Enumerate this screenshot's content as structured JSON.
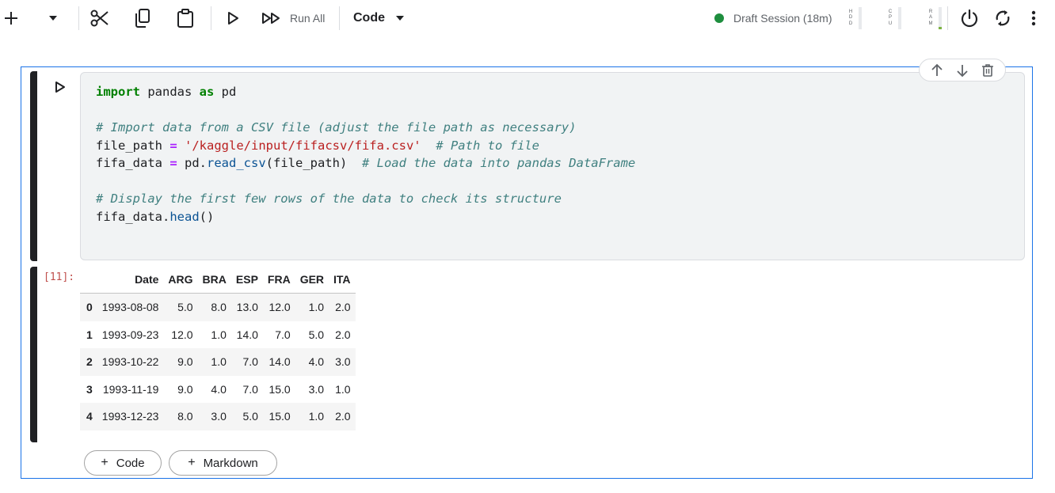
{
  "toolbar": {
    "add_icon": "plus-icon",
    "add_menu_icon": "chevron-down-icon",
    "cut_icon": "scissors-icon",
    "copy_icon": "copy-icon",
    "paste_icon": "clipboard-icon",
    "run_icon": "play-icon",
    "run_all_icon": "fast-forward-icon",
    "run_all_label": "Run All",
    "cell_type_label": "Code",
    "session_status": "Draft Session (18m)",
    "session_status_color": "#1e8e3e",
    "meters": [
      {
        "label": "HDD",
        "level": 0.0
      },
      {
        "label": "CPU",
        "level": 0.0
      },
      {
        "label": "RAM",
        "level": 0.1,
        "color": "#7cb342"
      }
    ],
    "power_icon": "power-icon",
    "refresh_icon": "refresh-icon",
    "more_icon": "more-vert-icon"
  },
  "cell": {
    "run_icon": "play-outline-icon",
    "actions": [
      "move-up-icon",
      "move-down-icon",
      "delete-icon"
    ],
    "code_lines": [
      "import pandas as pd",
      "",
      "# Import data from a CSV file (adjust the file path as necessary)",
      "file_path = '/kaggle/input/fifacsv/fifa.csv'  # Path to file",
      "fifa_data = pd.read_csv(file_path)  # Load the data into pandas DataFrame",
      "",
      "# Display the first few rows of the data to check its structure",
      "fifa_data.head()"
    ],
    "execution_count": "[11]:",
    "output_table": {
      "columns": [
        "",
        "Date",
        "ARG",
        "BRA",
        "ESP",
        "FRA",
        "GER",
        "ITA"
      ],
      "rows": [
        [
          "0",
          "1993-08-08",
          "5.0",
          "8.0",
          "13.0",
          "12.0",
          "1.0",
          "2.0"
        ],
        [
          "1",
          "1993-09-23",
          "12.0",
          "1.0",
          "14.0",
          "7.0",
          "5.0",
          "2.0"
        ],
        [
          "2",
          "1993-10-22",
          "9.0",
          "1.0",
          "7.0",
          "14.0",
          "4.0",
          "3.0"
        ],
        [
          "3",
          "1993-11-19",
          "9.0",
          "4.0",
          "7.0",
          "15.0",
          "3.0",
          "1.0"
        ],
        [
          "4",
          "1993-12-23",
          "8.0",
          "3.0",
          "5.0",
          "15.0",
          "1.0",
          "2.0"
        ]
      ]
    }
  },
  "add_cell": {
    "code_label": "Code",
    "markdown_label": "Markdown",
    "plus": "+"
  },
  "colors": {
    "accent": "#1a73e8",
    "keyword": "#008000",
    "comment": "#408080",
    "string": "#ba2121",
    "operator": "#aa22ff",
    "function": "#0b5394",
    "exec_count": "#c0504d"
  }
}
